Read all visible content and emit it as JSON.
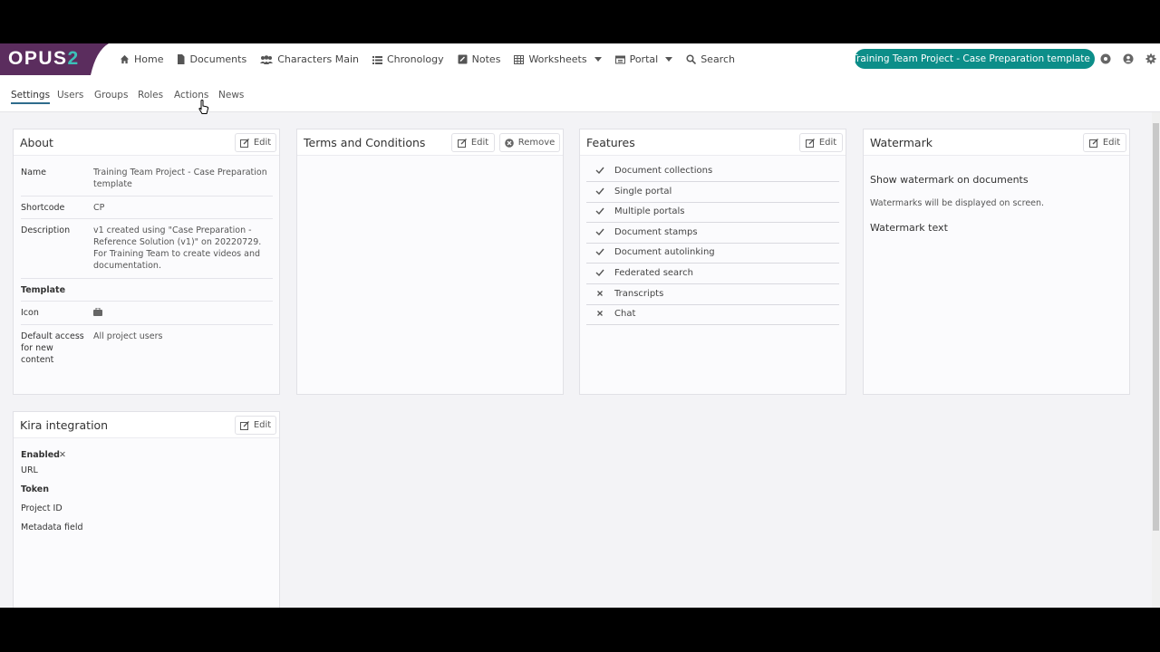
{
  "brand": {
    "logo_main": "OPUS",
    "logo_accent": "2"
  },
  "nav": {
    "home": "Home",
    "documents": "Documents",
    "characters": "Characters Main",
    "chronology": "Chronology",
    "notes": "Notes",
    "worksheets": "Worksheets",
    "portal": "Portal",
    "search": "Search"
  },
  "project_selector": "Training Team Project - Case Preparation template",
  "tabs": [
    "Settings",
    "Users",
    "Groups",
    "Roles",
    "Actions",
    "News"
  ],
  "about": {
    "title": "About",
    "edit": "Edit",
    "name_label": "Name",
    "name_value": "Training Team Project - Case Preparation template",
    "shortcode_label": "Shortcode",
    "shortcode_value": "CP",
    "description_label": "Description",
    "description_value": "v1 created using \"Case Preparation - Reference Solution (v1)\" on 20220729. For Training Team to create videos and documentation.",
    "template_label": "Template",
    "icon_label": "Icon",
    "default_access_label": "Default access for new content",
    "default_access_value": "All project users"
  },
  "terms": {
    "title": "Terms and Conditions",
    "edit": "Edit",
    "remove": "Remove"
  },
  "features": {
    "title": "Features",
    "edit": "Edit",
    "items": [
      {
        "label": "Document collections",
        "enabled": true
      },
      {
        "label": "Single portal",
        "enabled": true
      },
      {
        "label": "Multiple portals",
        "enabled": true
      },
      {
        "label": "Document stamps",
        "enabled": true
      },
      {
        "label": "Document autolinking",
        "enabled": true
      },
      {
        "label": "Federated search",
        "enabled": true
      },
      {
        "label": "Transcripts",
        "enabled": false
      },
      {
        "label": "Chat",
        "enabled": false
      }
    ]
  },
  "watermark": {
    "title": "Watermark",
    "edit": "Edit",
    "show_heading": "Show watermark on documents",
    "show_text": "Watermarks will be displayed on screen.",
    "text_heading": "Watermark text"
  },
  "kira": {
    "title": "Kira integration",
    "edit": "Edit",
    "enabled_label": "Enabled",
    "enabled_mark": "✕",
    "url_label": "URL",
    "token_label": "Token",
    "project_id_label": "Project ID",
    "metadata_label": "Metadata field"
  },
  "colors": {
    "brand_purple": "#5b2d5e",
    "teal": "#0c8e89",
    "active_tab": "#2e6c8c"
  },
  "icons": [
    "home-icon",
    "document-icon",
    "people-icon",
    "list-icon",
    "notes-icon",
    "grid-icon",
    "portal-icon",
    "search-icon",
    "help-icon",
    "user-icon",
    "gear-icon",
    "edit-icon",
    "remove-icon",
    "check-icon",
    "x-icon",
    "briefcase-icon"
  ]
}
